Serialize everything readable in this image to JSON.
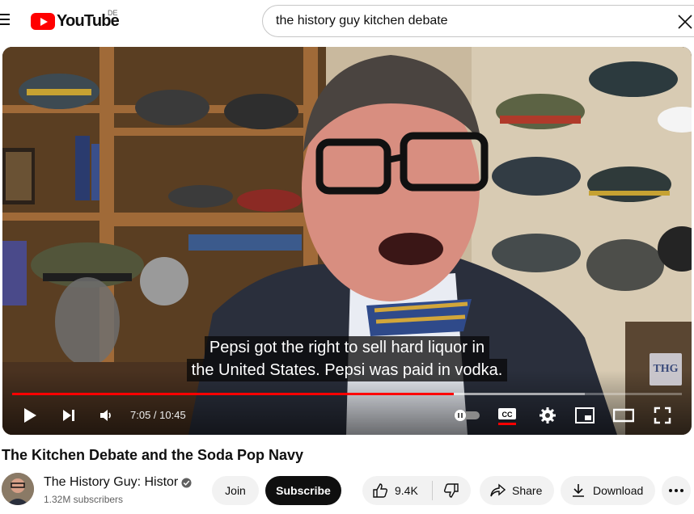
{
  "header": {
    "logo_text": "YouTube",
    "region": "DE",
    "search_value": "the history guy kitchen debate"
  },
  "player": {
    "caption_line1": "Pepsi got the right to sell hard liquor in",
    "caption_line2": "the United States. Pepsi was paid in vodka.",
    "time_display": "7:05 / 10:45",
    "progress_fraction": 0.659,
    "buffer_fraction": 0.855,
    "watermark": "THG",
    "accent": "#ff0000"
  },
  "video": {
    "title": "The Kitchen Debate and the Soda Pop Navy",
    "channel_name": "The History Guy: Histor",
    "subscribers": "1.32M subscribers"
  },
  "actions": {
    "join": "Join",
    "subscribe": "Subscribe",
    "likes": "9.4K",
    "share": "Share",
    "download": "Download"
  },
  "icons": [
    "menu-icon",
    "clear-icon",
    "play-icon",
    "next-icon",
    "volume-icon",
    "autoplay-toggle",
    "captions-icon",
    "settings-icon",
    "miniplayer-icon",
    "theater-icon",
    "fullscreen-icon",
    "verified-icon",
    "like-icon",
    "dislike-icon",
    "share-icon",
    "download-icon",
    "more-icon"
  ]
}
